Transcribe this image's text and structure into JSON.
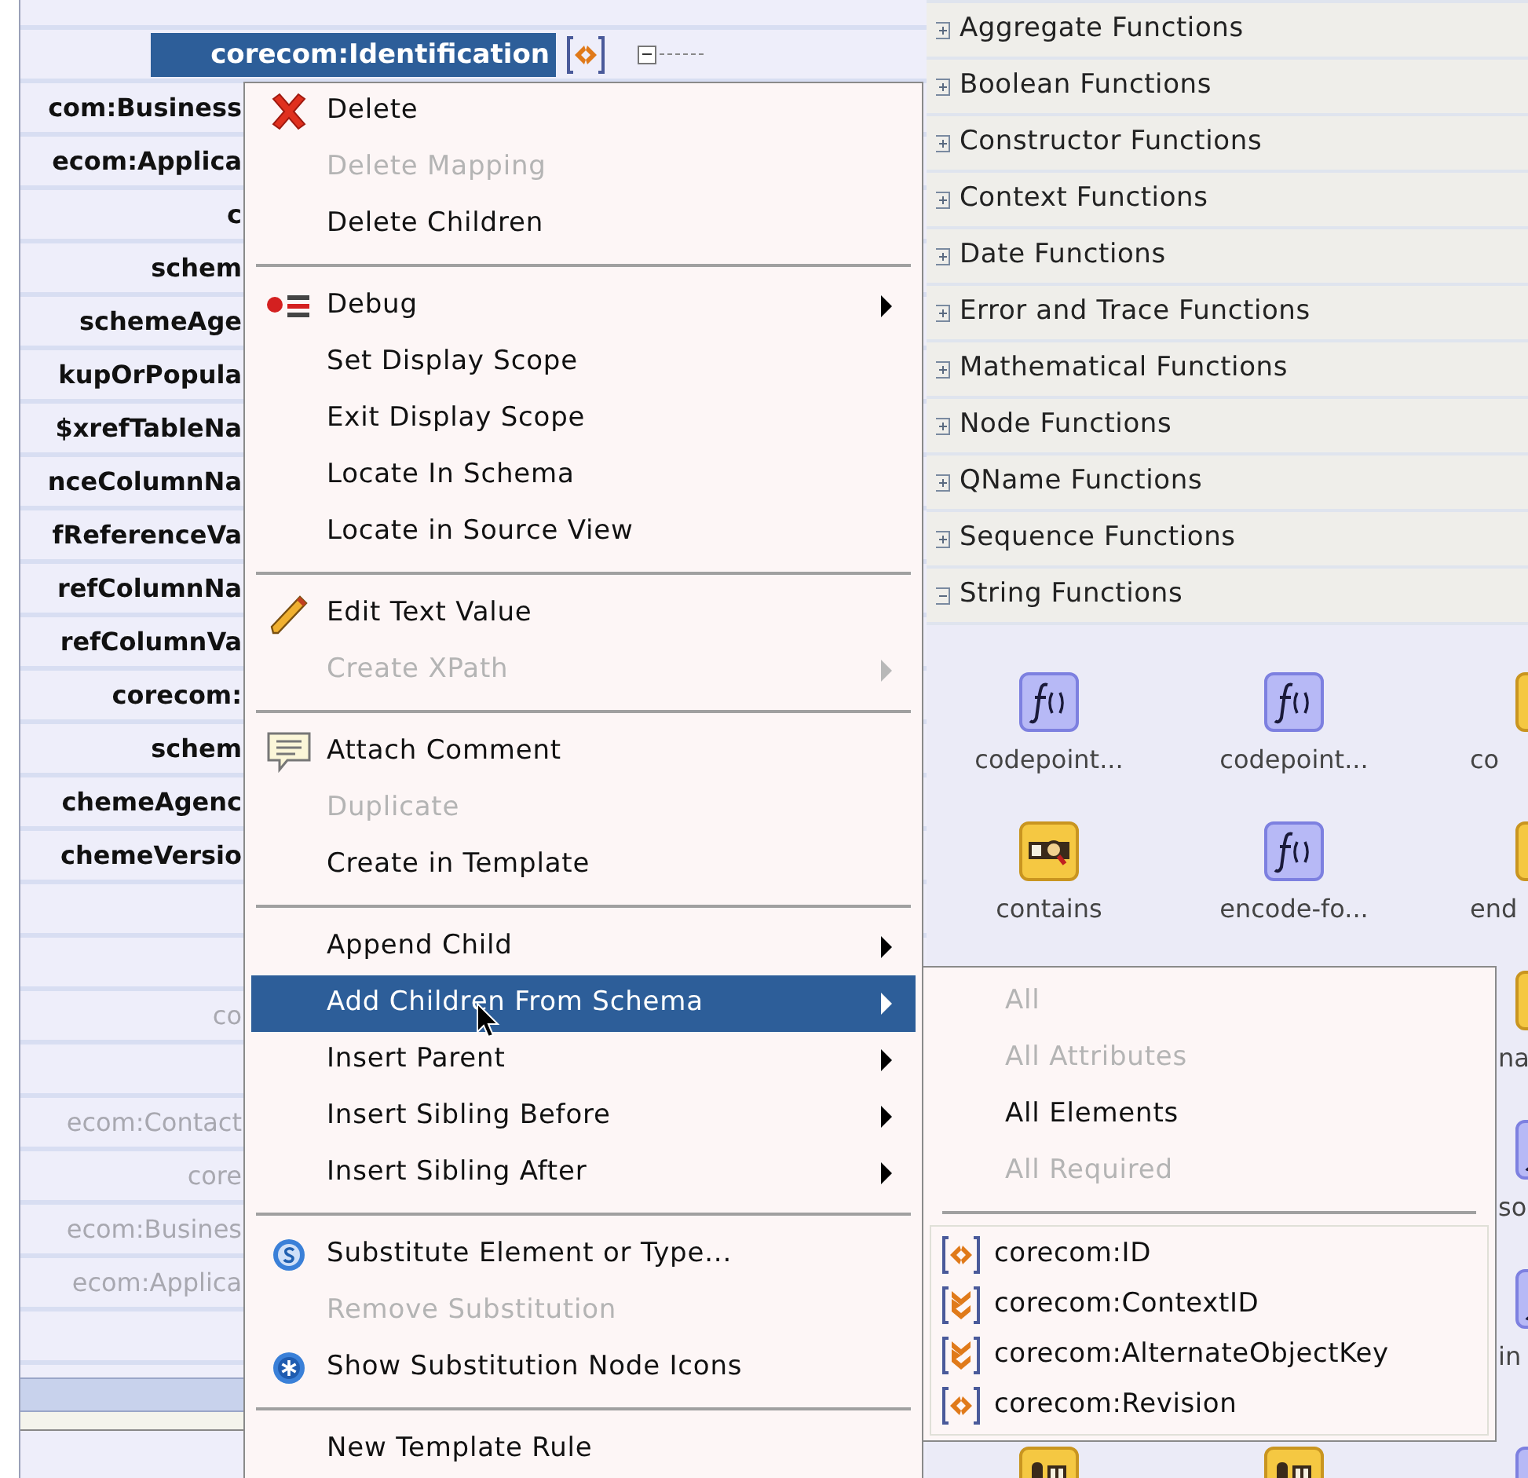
{
  "mapping_tree": {
    "rows": [
      {
        "kind": "parent",
        "label": "corecom:Identification",
        "selected": true,
        "dimmed": false
      },
      {
        "kind": "node",
        "label": "com:Business",
        "selected": false,
        "dimmed": false
      },
      {
        "kind": "node",
        "label": "ecom:Applica",
        "selected": false,
        "dimmed": false
      },
      {
        "kind": "node",
        "label": "c",
        "selected": false,
        "dimmed": false
      },
      {
        "kind": "node",
        "label": "schem",
        "selected": false,
        "dimmed": false
      },
      {
        "kind": "node",
        "label": "schemeAge",
        "selected": false,
        "dimmed": false
      },
      {
        "kind": "node",
        "label": "kupOrPopula",
        "selected": false,
        "dimmed": false
      },
      {
        "kind": "node",
        "label": "$xrefTableNa",
        "selected": false,
        "dimmed": false
      },
      {
        "kind": "node",
        "label": "nceColumnNa",
        "selected": false,
        "dimmed": false
      },
      {
        "kind": "node",
        "label": "fReferenceVa",
        "selected": false,
        "dimmed": false
      },
      {
        "kind": "node",
        "label": "refColumnNa",
        "selected": false,
        "dimmed": false
      },
      {
        "kind": "node",
        "label": "refColumnVa",
        "selected": false,
        "dimmed": false
      },
      {
        "kind": "node",
        "label": "corecom:",
        "selected": false,
        "dimmed": false
      },
      {
        "kind": "node",
        "label": "schem",
        "selected": false,
        "dimmed": false
      },
      {
        "kind": "node",
        "label": "chemeAgenc",
        "selected": false,
        "dimmed": false
      },
      {
        "kind": "node",
        "label": "chemeVersio",
        "selected": false,
        "dimmed": false
      },
      {
        "kind": "blank"
      },
      {
        "kind": "blank"
      },
      {
        "kind": "node",
        "label": "co",
        "selected": false,
        "dimmed": true
      },
      {
        "kind": "blank"
      },
      {
        "kind": "node",
        "label": "ecom:Contact",
        "selected": false,
        "dimmed": true
      },
      {
        "kind": "node",
        "label": "core",
        "selected": false,
        "dimmed": true
      },
      {
        "kind": "node",
        "label": "ecom:Busines",
        "selected": false,
        "dimmed": true
      },
      {
        "kind": "node",
        "label": "ecom:Applica",
        "selected": false,
        "dimmed": true
      },
      {
        "kind": "blank"
      }
    ]
  },
  "function_categories": [
    {
      "label": "Aggregate Functions",
      "expanded": false
    },
    {
      "label": "Boolean Functions",
      "expanded": false
    },
    {
      "label": "Constructor Functions",
      "expanded": false
    },
    {
      "label": "Context Functions",
      "expanded": false
    },
    {
      "label": "Date Functions",
      "expanded": false
    },
    {
      "label": "Error and Trace Functions",
      "expanded": false
    },
    {
      "label": "Mathematical Functions",
      "expanded": false
    },
    {
      "label": "Node Functions",
      "expanded": false
    },
    {
      "label": "QName Functions",
      "expanded": false
    },
    {
      "label": "Sequence Functions",
      "expanded": false
    },
    {
      "label": "String Functions",
      "expanded": true
    }
  ],
  "palette": {
    "rows": [
      {
        "cells": [
          {
            "kind": "function",
            "label": "codepoint..."
          },
          {
            "kind": "function",
            "label": "codepoint..."
          },
          {
            "kind": "operator",
            "label": "co"
          }
        ]
      },
      {
        "cells": [
          {
            "kind": "search",
            "label": "contains"
          },
          {
            "kind": "function",
            "label": "encode-fo..."
          },
          {
            "kind": "operator",
            "label": "end"
          }
        ]
      },
      {
        "cells": [
          {
            "kind": "operator",
            "label": "na"
          }
        ]
      },
      {
        "cells": [
          {
            "kind": "function",
            "label": "so"
          }
        ]
      },
      {
        "cells": [
          {
            "kind": "function",
            "label": "in"
          }
        ]
      },
      {
        "cells": [
          {
            "kind": "operator"
          },
          {
            "kind": "operator"
          },
          {
            "kind": "function"
          }
        ]
      }
    ]
  },
  "context_menu": {
    "items": [
      {
        "kind": "item",
        "label": "Delete",
        "disabled": false,
        "submenu": false,
        "selected": false
      },
      {
        "kind": "item",
        "label": "Delete Mapping",
        "disabled": true,
        "submenu": false,
        "selected": false
      },
      {
        "kind": "item",
        "label": "Delete Children",
        "disabled": false,
        "submenu": false,
        "selected": false
      },
      {
        "kind": "separator"
      },
      {
        "kind": "item",
        "label": "Debug",
        "disabled": false,
        "submenu": true,
        "selected": false
      },
      {
        "kind": "item",
        "label": "Set Display Scope",
        "disabled": false,
        "submenu": false,
        "selected": false
      },
      {
        "kind": "item",
        "label": "Exit Display Scope",
        "disabled": false,
        "submenu": false,
        "selected": false
      },
      {
        "kind": "item",
        "label": "Locate In Schema",
        "disabled": false,
        "submenu": false,
        "selected": false
      },
      {
        "kind": "item",
        "label": "Locate in Source View",
        "disabled": false,
        "submenu": false,
        "selected": false
      },
      {
        "kind": "separator"
      },
      {
        "kind": "item",
        "label": "Edit Text Value",
        "disabled": false,
        "submenu": false,
        "selected": false
      },
      {
        "kind": "item",
        "label": "Create XPath",
        "disabled": true,
        "submenu": true,
        "selected": false
      },
      {
        "kind": "separator"
      },
      {
        "kind": "item",
        "label": "Attach Comment",
        "disabled": false,
        "submenu": false,
        "selected": false
      },
      {
        "kind": "item",
        "label": "Duplicate",
        "disabled": true,
        "submenu": false,
        "selected": false
      },
      {
        "kind": "item",
        "label": "Create in Template",
        "disabled": false,
        "submenu": false,
        "selected": false
      },
      {
        "kind": "separator"
      },
      {
        "kind": "item",
        "label": "Append Child",
        "disabled": false,
        "submenu": true,
        "selected": false
      },
      {
        "kind": "item",
        "label": "Add Children From Schema",
        "disabled": false,
        "submenu": true,
        "selected": true
      },
      {
        "kind": "item",
        "label": "Insert Parent",
        "disabled": false,
        "submenu": true,
        "selected": false
      },
      {
        "kind": "item",
        "label": "Insert Sibling Before",
        "disabled": false,
        "submenu": true,
        "selected": false
      },
      {
        "kind": "item",
        "label": "Insert Sibling After",
        "disabled": false,
        "submenu": true,
        "selected": false
      },
      {
        "kind": "separator"
      },
      {
        "kind": "item",
        "label": "Substitute Element or Type...",
        "disabled": false,
        "submenu": false,
        "selected": false
      },
      {
        "kind": "item",
        "label": "Remove Substitution",
        "disabled": true,
        "submenu": false,
        "selected": false
      },
      {
        "kind": "item",
        "label": "Show Substitution Node Icons",
        "disabled": false,
        "submenu": false,
        "selected": false
      },
      {
        "kind": "separator"
      },
      {
        "kind": "item",
        "label": "New Template Rule",
        "disabled": false,
        "submenu": false,
        "selected": false
      }
    ]
  },
  "submenu": {
    "options": [
      {
        "label": "All",
        "disabled": true
      },
      {
        "label": "All Attributes",
        "disabled": true
      },
      {
        "label": "All Elements",
        "disabled": false
      },
      {
        "label": "All Required",
        "disabled": true
      }
    ],
    "elements": [
      {
        "label": "corecom:ID",
        "kind": "simple"
      },
      {
        "label": "corecom:ContextID",
        "kind": "complex"
      },
      {
        "label": "corecom:AlternateObjectKey",
        "kind": "complex"
      },
      {
        "label": "corecom:Revision",
        "kind": "simple"
      }
    ]
  }
}
